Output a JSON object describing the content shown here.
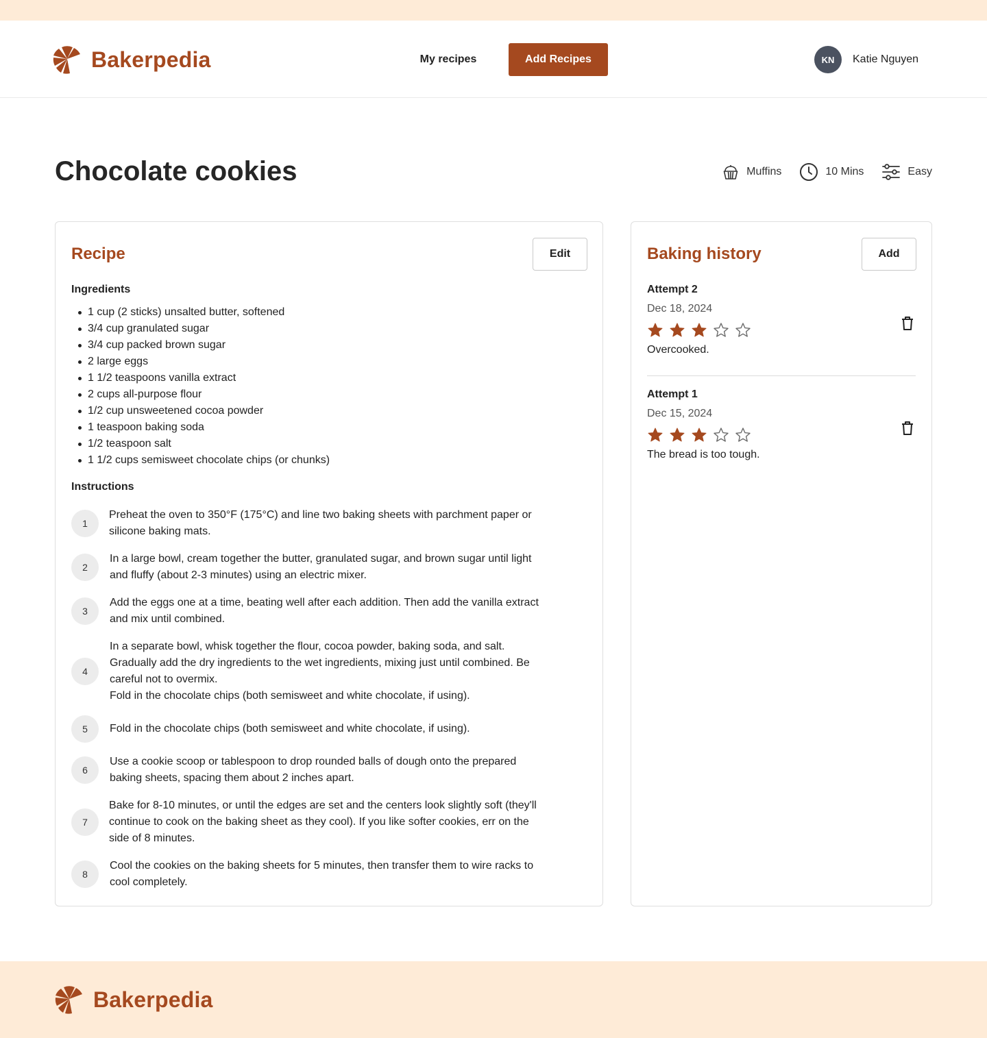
{
  "brand": {
    "name": "Bakerpedia",
    "color": "#a5491f"
  },
  "nav": {
    "my_recipes": "My recipes",
    "add_recipes": "Add Recipes"
  },
  "user": {
    "initials": "KN",
    "name": "Katie Nguyen"
  },
  "recipe": {
    "title": "Chocolate cookies",
    "meta": {
      "category": "Muffins",
      "time": "10 Mins",
      "difficulty": "Easy"
    },
    "card_title": "Recipe",
    "edit_label": "Edit",
    "ingredients_label": "Ingredients",
    "ingredients": [
      "1 cup (2 sticks) unsalted butter, softened",
      "3/4 cup granulated sugar",
      "3/4 cup packed brown sugar",
      "2 large eggs",
      "1 1/2 teaspoons vanilla extract",
      "2 cups all-purpose flour",
      "1/2 cup unsweetened cocoa powder",
      "1 teaspoon baking soda",
      "1/2 teaspoon salt",
      "1 1/2 cups semisweet chocolate chips (or chunks)"
    ],
    "instructions_label": "Instructions",
    "steps": [
      {
        "num": "1",
        "text": "Preheat the oven to 350°F (175°C) and line two baking sheets with parchment paper or\nsilicone baking mats."
      },
      {
        "num": "2",
        "text": "In a large bowl, cream together the butter, granulated sugar, and brown sugar until light\nand fluffy (about 2-3 minutes) using an electric mixer."
      },
      {
        "num": "3",
        "text": "Add the eggs one at a time, beating well after each addition. Then add the vanilla extract\nand mix until combined."
      },
      {
        "num": "4",
        "text": "In a separate bowl, whisk together the flour, cocoa powder, baking soda, and salt.\nGradually add the dry ingredients to the wet ingredients, mixing just until combined. Be\ncareful not to overmix.\nFold in the chocolate chips (both semisweet and white chocolate, if using)."
      },
      {
        "num": "5",
        "text": "Fold in the chocolate chips (both semisweet and white chocolate, if using)."
      },
      {
        "num": "6",
        "text": "Use a cookie scoop or tablespoon to drop rounded balls of dough onto the prepared\nbaking sheets, spacing them about 2 inches apart."
      },
      {
        "num": "7",
        "text": "Bake for 8-10 minutes, or until the edges are set and the centers look slightly soft (they'll\ncontinue to cook on the baking sheet as they cool). If you like softer cookies, err on the\nside of 8 minutes."
      },
      {
        "num": "8",
        "text": "Cool the cookies on the baking sheets for 5 minutes, then transfer them to wire racks to\ncool completely."
      }
    ]
  },
  "history": {
    "card_title": "Baking history",
    "add_label": "Add",
    "attempts": [
      {
        "title": "Attempt 2",
        "date": "Dec 18, 2024",
        "rating": 3,
        "max_rating": 5,
        "note": "Overcooked."
      },
      {
        "title": "Attempt 1",
        "date": "Dec 15, 2024",
        "rating": 3,
        "max_rating": 5,
        "note": "The bread is too tough."
      }
    ]
  },
  "icons": {
    "logo": "croissant-icon",
    "category": "cupcake-icon",
    "time": "clock-icon",
    "difficulty": "sliders-icon",
    "delete": "trash-icon",
    "rating": "star-icon"
  },
  "colors": {
    "accent": "#a5491f",
    "banner": "#feebd7",
    "avatar": "#4b5260",
    "star_filled": "#a5491f",
    "star_empty": "#6b6b6b"
  }
}
